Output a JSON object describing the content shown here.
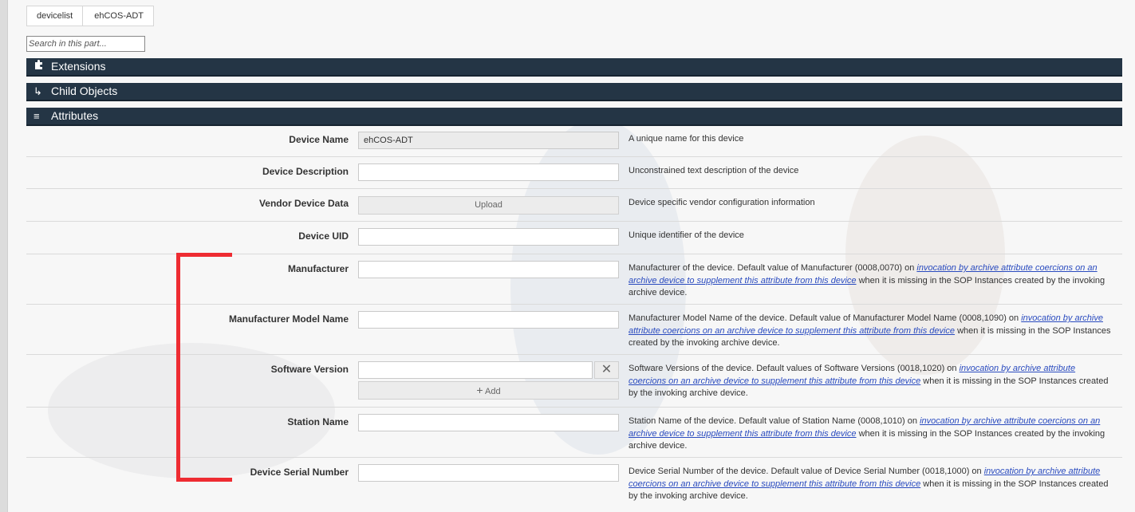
{
  "breadcrumb": {
    "items": [
      "devicelist",
      "ehCOS-ADT"
    ]
  },
  "search": {
    "placeholder": "Search in this part..."
  },
  "sections": {
    "extensions": "Extensions",
    "child_objects": "Child Objects",
    "attributes": "Attributes"
  },
  "icons": {
    "extensions": "puzzle-icon",
    "child_objects": "return-arrow-icon",
    "attributes": "list-icon",
    "remove": "close-icon",
    "add": "plus-icon"
  },
  "attributes": {
    "device_name": {
      "label": "Device Name",
      "value": "ehCOS-ADT",
      "desc": "A unique name for this device"
    },
    "device_description": {
      "label": "Device Description",
      "value": "",
      "desc": "Unconstrained text description of the device"
    },
    "vendor_device_data": {
      "label": "Vendor Device Data",
      "button": "Upload",
      "desc": "Device specific vendor configuration information"
    },
    "device_uid": {
      "label": "Device UID",
      "value": "",
      "desc": "Unique identifier of the device"
    },
    "manufacturer": {
      "label": "Manufacturer",
      "value": "",
      "desc_pre": "Manufacturer of the device. Default value of Manufacturer (0008,0070) on ",
      "link": "invocation by archive attribute coercions on an archive device to supplement this attribute from this device",
      "desc_post": " when it is missing in the SOP Instances created by the invoking archive device."
    },
    "manufacturer_model_name": {
      "label": "Manufacturer Model Name",
      "value": "",
      "desc_pre": "Manufacturer Model Name of the device. Default value of Manufacturer Model Name (0008,1090) on ",
      "link": "invocation by archive attribute coercions on an archive device to supplement this attribute from this device",
      "desc_post": " when it is missing in the SOP Instances created by the invoking archive device."
    },
    "software_version": {
      "label": "Software Version",
      "value": "",
      "add_label": "Add",
      "desc_pre": "Software Versions of the device. Default values of Software Versions (0018,1020) on ",
      "link": "invocation by archive attribute coercions on an archive device to supplement this attribute from this device",
      "desc_post": " when it is missing in the SOP Instances created by the invoking archive device."
    },
    "station_name": {
      "label": "Station Name",
      "value": "",
      "desc_pre": "Station Name of the device. Default value of Station Name (0008,1010) on ",
      "link": "invocation by archive attribute coercions on an archive device to supplement this attribute from this device",
      "desc_post": " when it is missing in the SOP Instances created by the invoking archive device."
    },
    "device_serial_number": {
      "label": "Device Serial Number",
      "value": "",
      "desc_pre": "Device Serial Number of the device. Default value of Device Serial Number (0018,1000) on ",
      "link": "invocation by archive attribute coercions on an archive device to supplement this attribute from this device",
      "desc_post": " when it is missing in the SOP Instances created by the invoking archive device."
    }
  },
  "colors": {
    "section_bar": "#243545",
    "link": "#2a4bbf",
    "annotation": "#ee2c32"
  }
}
